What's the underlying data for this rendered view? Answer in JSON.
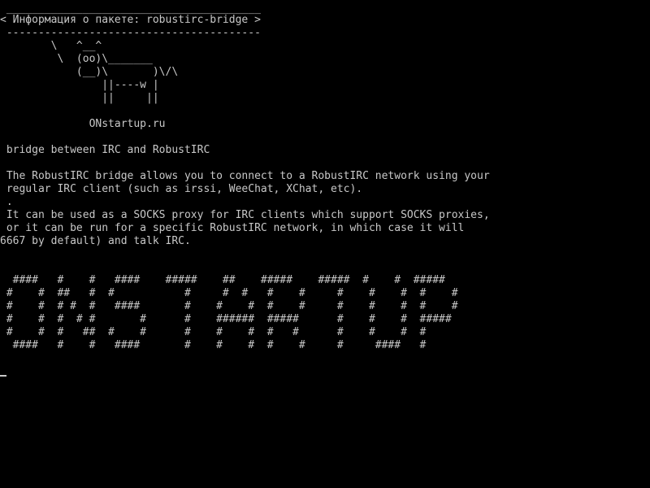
{
  "terminal": {
    "colors": {
      "background": "#000000",
      "foreground": "#c8c8c8"
    },
    "lines": [
      " ________________________________________",
      "< Информация о пакете: robustirc-bridge >",
      " ----------------------------------------",
      "        \\   ^__^",
      "         \\  (oo)\\_______",
      "            (__)\\       )\\/\\",
      "                ||----w |",
      "                ||     ||",
      "",
      "              ONstartup.ru",
      "",
      " bridge between IRC and RobustIRC",
      "",
      " The RobustIRC bridge allows you to connect to a RobustIRC network using your",
      " regular IRC client (such as irssi, WeeChat, XChat, etc).",
      " .",
      " It can be used as a SOCKS proxy for IRC clients which support SOCKS proxies,",
      " or it can be run for a specific RobustIRC network, in which case it will",
      "6667 by default) and talk IRC.",
      "",
      "",
      "  ####   #    #   ####    #####    ##    #####    #####  #    #  #####",
      " #    #  ##   #  #           #     #  #   #    #     #    #    #  #    #",
      " #    #  # #  #   ####       #    #    #  #    #     #    #    #  #    #",
      " #    #  #  # #       #      #    ######  #####      #    #    #  #####",
      " #    #  #   ##  #    #      #    #    #  #   #      #    #    #  #",
      "  ####   #    #   ####       #    #    #  #    #     #     ####   #"
    ]
  }
}
